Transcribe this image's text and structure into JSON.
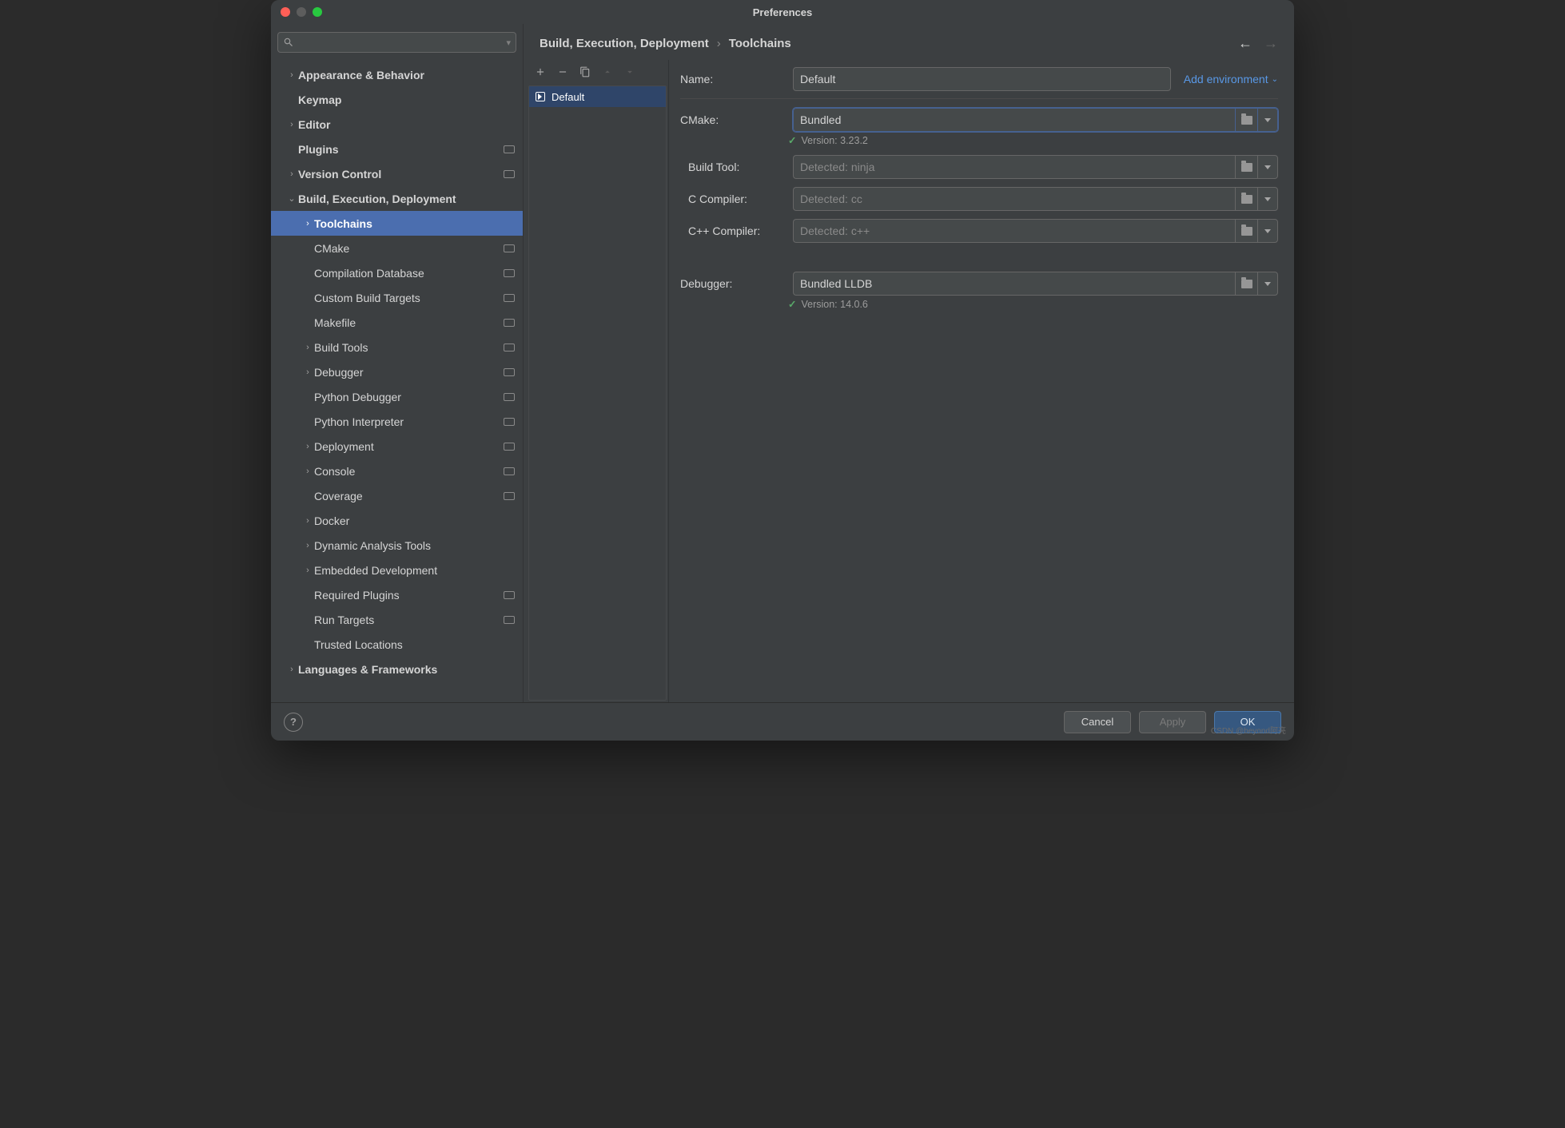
{
  "window": {
    "title": "Preferences"
  },
  "search": {
    "placeholder": ""
  },
  "tree": [
    {
      "label": "Appearance & Behavior",
      "level": 0,
      "expandable": true,
      "expanded": false,
      "bold": true
    },
    {
      "label": "Keymap",
      "level": 0,
      "expandable": false,
      "bold": true
    },
    {
      "label": "Editor",
      "level": 0,
      "expandable": true,
      "expanded": false,
      "bold": true
    },
    {
      "label": "Plugins",
      "level": 0,
      "expandable": false,
      "bold": true,
      "trailing": true
    },
    {
      "label": "Version Control",
      "level": 0,
      "expandable": true,
      "expanded": false,
      "bold": true,
      "trailing": true
    },
    {
      "label": "Build, Execution, Deployment",
      "level": 0,
      "expandable": true,
      "expanded": true,
      "bold": true
    },
    {
      "label": "Toolchains",
      "level": 1,
      "expandable": true,
      "expanded": false,
      "bold": true,
      "selected": true
    },
    {
      "label": "CMake",
      "level": 1,
      "expandable": false,
      "bold": false,
      "trailing": true
    },
    {
      "label": "Compilation Database",
      "level": 1,
      "expandable": false,
      "bold": false,
      "trailing": true
    },
    {
      "label": "Custom Build Targets",
      "level": 1,
      "expandable": false,
      "bold": false,
      "trailing": true
    },
    {
      "label": "Makefile",
      "level": 1,
      "expandable": false,
      "bold": false,
      "trailing": true
    },
    {
      "label": "Build Tools",
      "level": 1,
      "expandable": true,
      "expanded": false,
      "bold": false,
      "trailing": true
    },
    {
      "label": "Debugger",
      "level": 1,
      "expandable": true,
      "expanded": false,
      "bold": false,
      "trailing": true
    },
    {
      "label": "Python Debugger",
      "level": 1,
      "expandable": false,
      "bold": false,
      "trailing": true
    },
    {
      "label": "Python Interpreter",
      "level": 1,
      "expandable": false,
      "bold": false,
      "trailing": true
    },
    {
      "label": "Deployment",
      "level": 1,
      "expandable": true,
      "expanded": false,
      "bold": false,
      "trailing": true
    },
    {
      "label": "Console",
      "level": 1,
      "expandable": true,
      "expanded": false,
      "bold": false,
      "trailing": true
    },
    {
      "label": "Coverage",
      "level": 1,
      "expandable": false,
      "bold": false,
      "trailing": true
    },
    {
      "label": "Docker",
      "level": 1,
      "expandable": true,
      "expanded": false,
      "bold": false
    },
    {
      "label": "Dynamic Analysis Tools",
      "level": 1,
      "expandable": true,
      "expanded": false,
      "bold": false
    },
    {
      "label": "Embedded Development",
      "level": 1,
      "expandable": true,
      "expanded": false,
      "bold": false
    },
    {
      "label": "Required Plugins",
      "level": 1,
      "expandable": false,
      "bold": false,
      "trailing": true
    },
    {
      "label": "Run Targets",
      "level": 1,
      "expandable": false,
      "bold": false,
      "trailing": true
    },
    {
      "label": "Trusted Locations",
      "level": 1,
      "expandable": false,
      "bold": false
    },
    {
      "label": "Languages & Frameworks",
      "level": 0,
      "expandable": true,
      "expanded": false,
      "bold": true
    }
  ],
  "breadcrumb": {
    "parent": "Build, Execution, Deployment",
    "current": "Toolchains"
  },
  "list": {
    "items": [
      "Default"
    ]
  },
  "form": {
    "name_label": "Name:",
    "name_value": "Default",
    "add_env": "Add environment",
    "cmake_label": "CMake:",
    "cmake_value": "Bundled",
    "cmake_status": "Version: 3.23.2",
    "build_tool_label": "Build Tool:",
    "build_tool_placeholder": "Detected: ninja",
    "c_compiler_label": "C Compiler:",
    "c_compiler_placeholder": "Detected: cc",
    "cpp_compiler_label": "C++ Compiler:",
    "cpp_compiler_placeholder": "Detected: c++",
    "debugger_label": "Debugger:",
    "debugger_value": "Bundled LLDB",
    "debugger_status": "Version: 14.0.6"
  },
  "footer": {
    "cancel": "Cancel",
    "apply": "Apply",
    "ok": "OK"
  },
  "watermark": "CSDN @beyond阿亮"
}
